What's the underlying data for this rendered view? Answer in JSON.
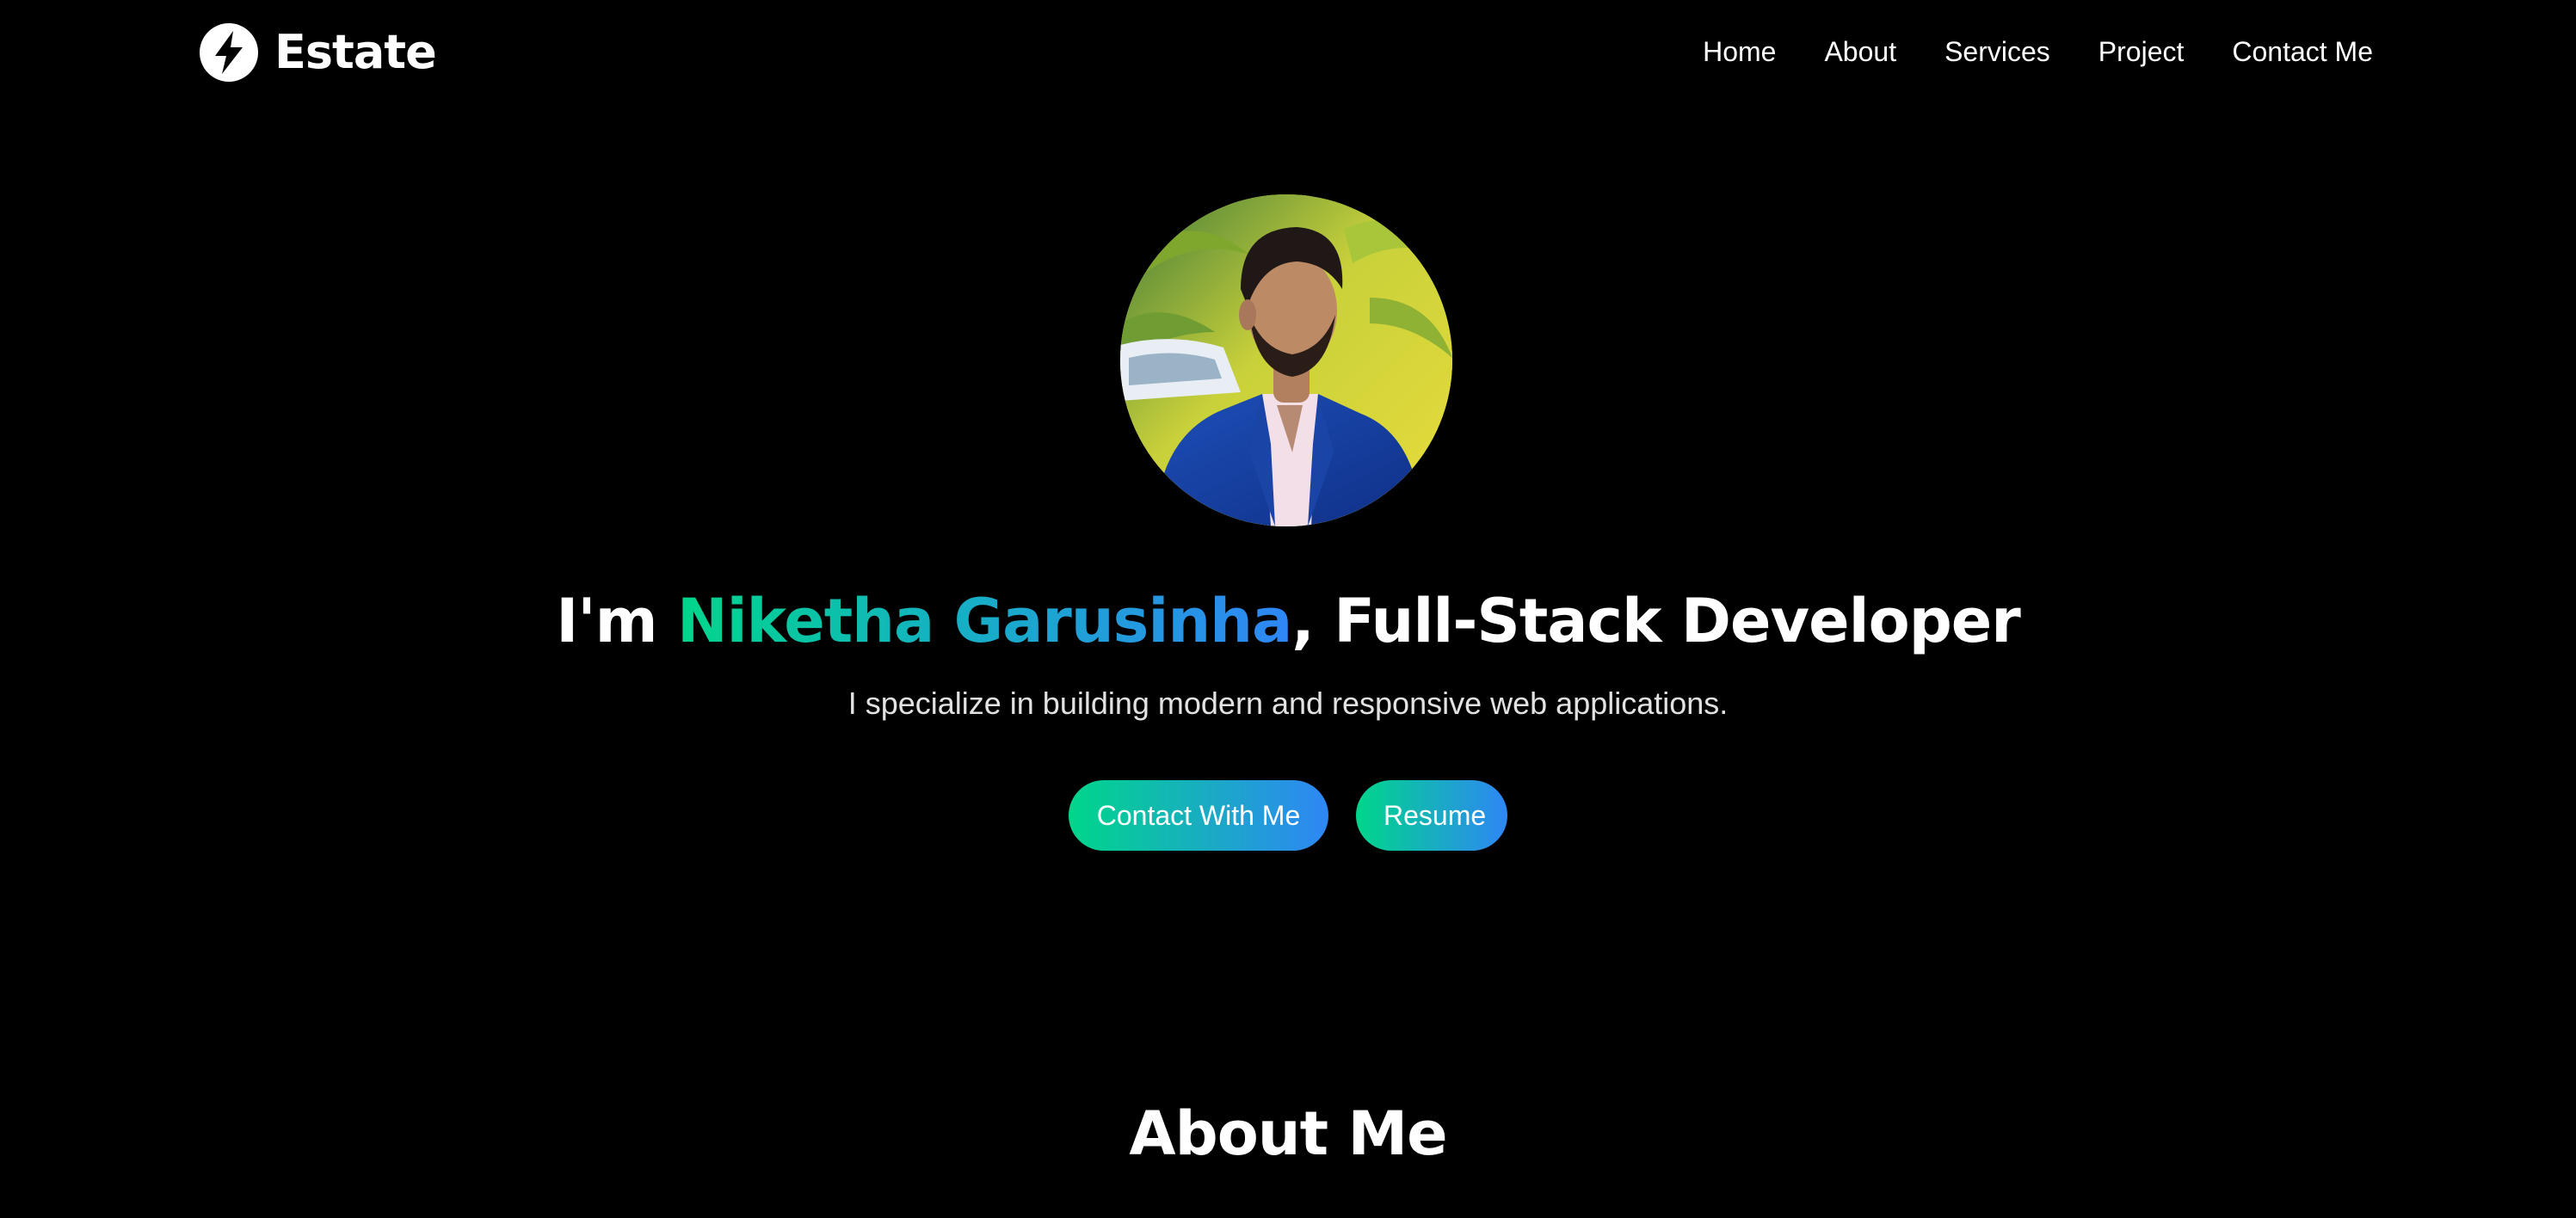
{
  "header": {
    "brand_name": "Estate",
    "nav": [
      {
        "label": "Home"
      },
      {
        "label": "About"
      },
      {
        "label": "Services"
      },
      {
        "label": "Project"
      },
      {
        "label": "Contact Me"
      }
    ]
  },
  "hero": {
    "title_prefix": "I'm ",
    "name": "Niketha Garusinha",
    "title_suffix": ", Full-Stack Developer",
    "subtitle": "I specialize in building modern and responsive web applications.",
    "buttons": {
      "contact_label": "Contact With Me",
      "resume_label": "Resume"
    }
  },
  "about": {
    "title": "About Me"
  },
  "colors": {
    "background": "#000000",
    "text": "#ffffff",
    "gradient_start": "#00d68a",
    "gradient_end": "#2f86f5"
  },
  "icons": {
    "logo": "lightning-bolt-circle-icon",
    "avatar": "profile-photo"
  }
}
